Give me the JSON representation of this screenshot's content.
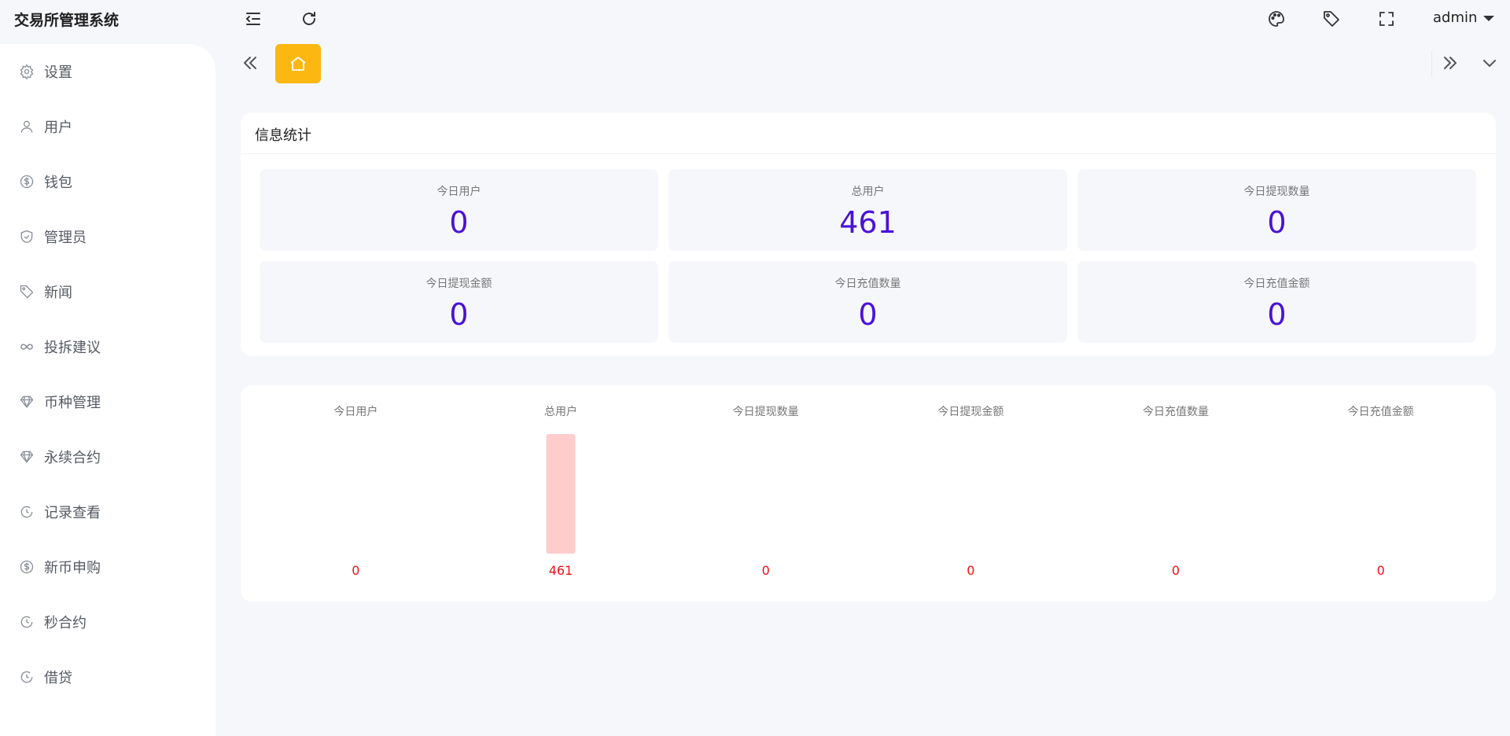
{
  "app": {
    "title": "交易所管理系统",
    "user": "admin"
  },
  "header_icons": [
    "menu-fold-icon",
    "refresh-icon",
    "palette-icon",
    "tag-icon",
    "fullscreen-icon"
  ],
  "sidebar": {
    "items": [
      {
        "label": "设置",
        "icon": "gear-icon"
      },
      {
        "label": "用户",
        "icon": "user-icon"
      },
      {
        "label": "钱包",
        "icon": "dollar-circle-icon"
      },
      {
        "label": "管理员",
        "icon": "shield-check-icon"
      },
      {
        "label": "新闻",
        "icon": "tag-icon"
      },
      {
        "label": "投拆建议",
        "icon": "infinity-icon"
      },
      {
        "label": "币种管理",
        "icon": "diamond-icon"
      },
      {
        "label": "永续合约",
        "icon": "diamond-icon"
      },
      {
        "label": "记录查看",
        "icon": "clock-circle-icon"
      },
      {
        "label": "新币申购",
        "icon": "dollar-circle-icon"
      },
      {
        "label": "秒合约",
        "icon": "clock-circle-icon"
      },
      {
        "label": "借贷",
        "icon": "clock-circle-icon"
      }
    ]
  },
  "tabs": {
    "home_icon": "home-icon"
  },
  "stats": {
    "title": "信息统计",
    "cards": [
      {
        "label": "今日用户",
        "value": "0"
      },
      {
        "label": "总用户",
        "value": "461"
      },
      {
        "label": "今日提现数量",
        "value": "0"
      },
      {
        "label": "今日提现金额",
        "value": "0"
      },
      {
        "label": "今日充值数量",
        "value": "0"
      },
      {
        "label": "今日充值金额",
        "value": "0"
      }
    ],
    "value_color": "#4a12d8"
  },
  "chart_data": {
    "type": "bar",
    "categories": [
      "今日用户",
      "总用户",
      "今日提现数量",
      "今日提现金额",
      "今日充值数量",
      "今日充值金额"
    ],
    "values": [
      0,
      461,
      0,
      0,
      0,
      0
    ],
    "title": "",
    "xlabel": "",
    "ylabel": "",
    "ylim": [
      0,
      461
    ],
    "grid": false,
    "bar_color": "#ffcccc",
    "label_color": "#ee1111",
    "category_position": "top",
    "value_label_position": "bottom"
  }
}
